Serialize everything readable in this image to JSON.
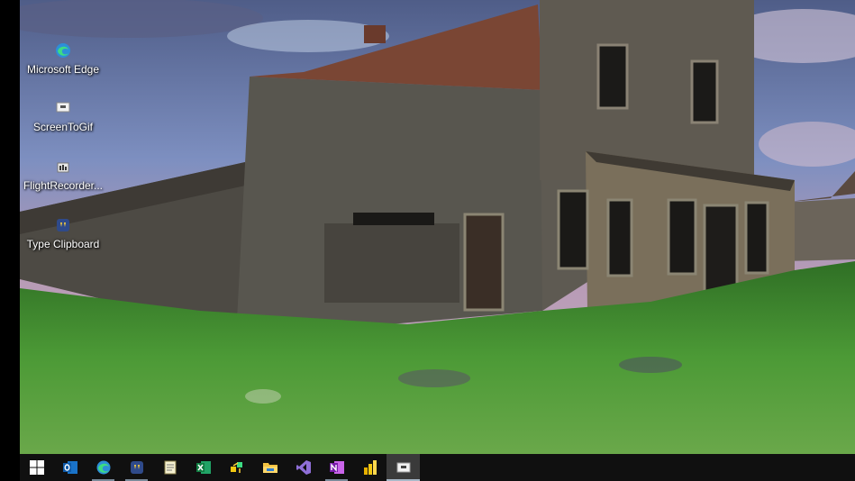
{
  "desktop": {
    "icons": [
      {
        "label": "Microsoft Edge",
        "icon": "edge-icon"
      },
      {
        "label": "ScreenToGif",
        "icon": "screentogif-icon"
      },
      {
        "label": "FlightRecorder...",
        "icon": "flightrecorder-icon"
      },
      {
        "label": "Type Clipboard",
        "icon": "type-clipboard-icon"
      }
    ]
  },
  "taskbar": {
    "items": [
      {
        "icon": "windows-start-icon",
        "state": "normal"
      },
      {
        "icon": "outlook-icon",
        "state": "normal"
      },
      {
        "icon": "edge-icon",
        "state": "running"
      },
      {
        "icon": "type-clipboard-icon",
        "state": "running"
      },
      {
        "icon": "notepad-icon",
        "state": "normal"
      },
      {
        "icon": "excel-icon",
        "state": "normal"
      },
      {
        "icon": "app-icon",
        "state": "normal"
      },
      {
        "icon": "file-explorer-icon",
        "state": "normal"
      },
      {
        "icon": "visual-studio-icon",
        "state": "normal"
      },
      {
        "icon": "onenote-icon",
        "state": "running"
      },
      {
        "icon": "power-bi-icon",
        "state": "normal"
      },
      {
        "icon": "screentogif-icon",
        "state": "active"
      }
    ]
  },
  "colors": {
    "taskbar_bg": "#101010",
    "desktop_label": "#ffffff",
    "sky": "#6f7fa8",
    "grass": "#3f8a2c",
    "wood": "#5a5346"
  }
}
